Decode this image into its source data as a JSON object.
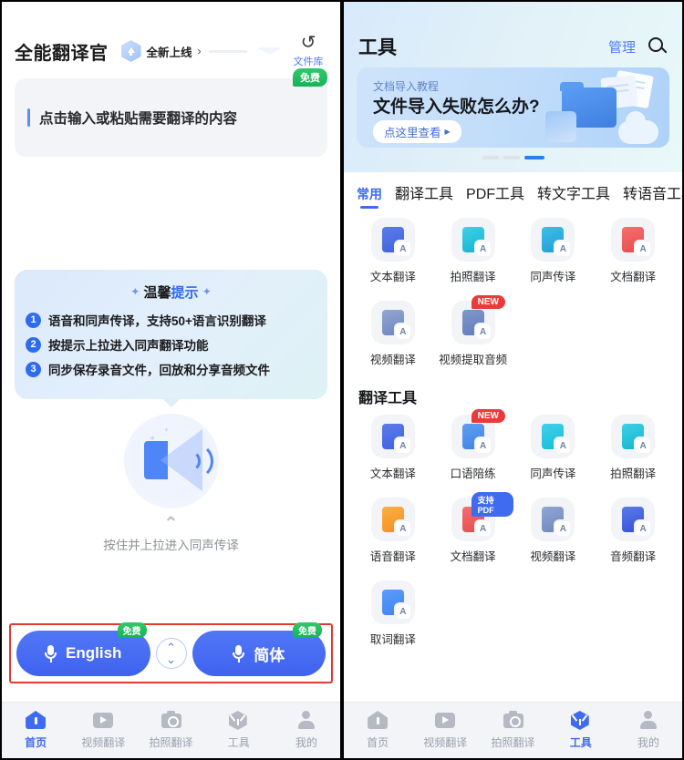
{
  "left": {
    "header": {
      "app_title": "全能翻译官",
      "badge_label": "全新上线",
      "chevron": "›",
      "file_lib_label": "文件库",
      "file_lib_icon": "history-clock-icon"
    },
    "input": {
      "placeholder": "点击输入或粘贴需要翻译的内容",
      "free_badge": "免费"
    },
    "tips": {
      "title_a": "温馨",
      "title_b": "提示",
      "sparkle": "✦",
      "items": [
        {
          "num": "1",
          "text": "语音和同声传译，支持50+语言识别翻译"
        },
        {
          "num": "2",
          "text": "按提示上拉进入同声翻译功能"
        },
        {
          "num": "3",
          "text": "同步保存录音文件，回放和分享音频文件"
        }
      ]
    },
    "pull": {
      "chevron": "⌃",
      "text": "按住并上拉进入同声传译"
    },
    "lang_bar": {
      "source_label": "English",
      "source_free": "免费",
      "target_label": "简体",
      "target_free": "免费",
      "swap_icon": "swap-vertical-icon"
    },
    "tabbar": [
      {
        "label": "首页",
        "icon": "home-icon",
        "active": true
      },
      {
        "label": "视频翻译",
        "icon": "video-icon",
        "active": false
      },
      {
        "label": "拍照翻译",
        "icon": "camera-icon",
        "active": false
      },
      {
        "label": "工具",
        "icon": "cube-icon",
        "active": false
      },
      {
        "label": "我的",
        "icon": "user-icon",
        "active": false
      }
    ]
  },
  "right": {
    "header": {
      "title": "工具",
      "manage_label": "管理",
      "search_icon": "search-icon"
    },
    "banner": {
      "subtitle": "文档导入教程",
      "title": "文件导入失败怎么办?",
      "cta_label": "点这里查看",
      "cta_arrow": "▶",
      "dots": [
        {
          "active": false
        },
        {
          "active": false
        },
        {
          "active": true
        }
      ]
    },
    "tabs": [
      {
        "label": "常用",
        "active": true
      },
      {
        "label": "翻译工具",
        "active": false
      },
      {
        "label": "PDF工具",
        "active": false
      },
      {
        "label": "转文字工具",
        "active": false
      },
      {
        "label": "转语音工具",
        "active": false
      }
    ],
    "common_tools": [
      {
        "label": "文本翻译",
        "icon": "text-translate-icon",
        "color": "#4a6fe0",
        "badge": ""
      },
      {
        "label": "拍照翻译",
        "icon": "photo-translate-icon",
        "color": "#1ec0d6",
        "badge": ""
      },
      {
        "label": "同声传译",
        "icon": "simultaneous-interpret-icon",
        "color": "#2aa8dd",
        "badge": ""
      },
      {
        "label": "文档翻译",
        "icon": "document-translate-icon",
        "color": "#ef5a5a",
        "badge": ""
      },
      {
        "label": "视频翻译",
        "icon": "video-translate-icon",
        "color": "#7e94c8",
        "badge": ""
      },
      {
        "label": "视频提取音频",
        "icon": "video-extract-audio-icon",
        "color": "#6f8fd2",
        "badge": "NEW"
      }
    ],
    "section_translate": {
      "title": "翻译工具",
      "tools": [
        {
          "label": "文本翻译",
          "icon": "text-translate-icon",
          "color": "#4a6fe0",
          "badge": ""
        },
        {
          "label": "口语陪练",
          "icon": "speaking-practice-icon",
          "color": "#3f84e8",
          "badge": "NEW"
        },
        {
          "label": "同声传译",
          "icon": "simultaneous-interpret-icon",
          "color": "#1fbfdc",
          "badge": ""
        },
        {
          "label": "拍照翻译",
          "icon": "photo-translate-icon",
          "color": "#1ec0d6",
          "badge": ""
        },
        {
          "label": "语音翻译",
          "icon": "voice-translate-icon",
          "color": "#f79a2b",
          "badge": ""
        },
        {
          "label": "文档翻译",
          "icon": "document-translate-icon",
          "color": "#ef5a5a",
          "badge": "支持PDF"
        },
        {
          "label": "视频翻译",
          "icon": "video-translate-icon",
          "color": "#7e94c8",
          "badge": ""
        },
        {
          "label": "音频翻译",
          "icon": "audio-translate-icon",
          "color": "#3f62e0",
          "badge": ""
        },
        {
          "label": "取词翻译",
          "icon": "word-pick-translate-icon",
          "color": "#3f84f5",
          "badge": ""
        }
      ]
    },
    "tabbar": [
      {
        "label": "首页",
        "icon": "home-icon",
        "active": false
      },
      {
        "label": "视频翻译",
        "icon": "video-icon",
        "active": false
      },
      {
        "label": "拍照翻译",
        "icon": "camera-icon",
        "active": false
      },
      {
        "label": "工具",
        "icon": "cube-icon",
        "active": true
      },
      {
        "label": "我的",
        "icon": "user-icon",
        "active": false
      }
    ]
  },
  "colors": {
    "primary": "#3f6bf0",
    "free_green": "#16b357",
    "new_red": "#ea3b3b",
    "highlight_box": "#e03b2f"
  }
}
